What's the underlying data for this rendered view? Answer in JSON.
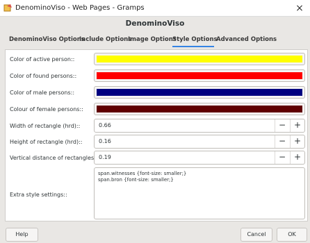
{
  "window": {
    "title": "DenominoViso - Web Pages - Gramps"
  },
  "header": {
    "title": "DenominoViso"
  },
  "tabs": [
    {
      "label": "DenominoViso Options"
    },
    {
      "label": "Include Options"
    },
    {
      "label": "Image Options"
    },
    {
      "label": "Style Options"
    },
    {
      "label": "Advanced Options"
    }
  ],
  "active_tab": "Style Options",
  "colors": {
    "active_person": "#ffff00",
    "found_persons": "#ff0000",
    "male_persons": "#000080",
    "female_persons": "#600000",
    "tab_underline": "#3584e4"
  },
  "fields": {
    "active_person_label": "Color of active person::",
    "found_persons_label": "Color of found persons::",
    "male_persons_label": "Color of male persons::",
    "female_persons_label": "Colour of female persons::",
    "width_label": "Width of rectangle (hrd)::",
    "width_value": "0.66",
    "height_label": "Height of rectangle (hrd)::",
    "height_value": "0.16",
    "vdist_label": "Vertical distance of rectangles (hrd)::",
    "vdist_value": "0.19",
    "extra_label": "Extra style settings::",
    "extra_lines": [
      "span.witnesses {font-size: smaller;}",
      "span.bron {font-size: smaller;}"
    ]
  },
  "spin": {
    "minus": "−",
    "plus": "+"
  },
  "buttons": {
    "help": "Help",
    "cancel": "Cancel",
    "ok": "OK"
  },
  "icons": {
    "app": "gramps-app-icon",
    "close": "close-icon",
    "close_glyph": "×"
  }
}
